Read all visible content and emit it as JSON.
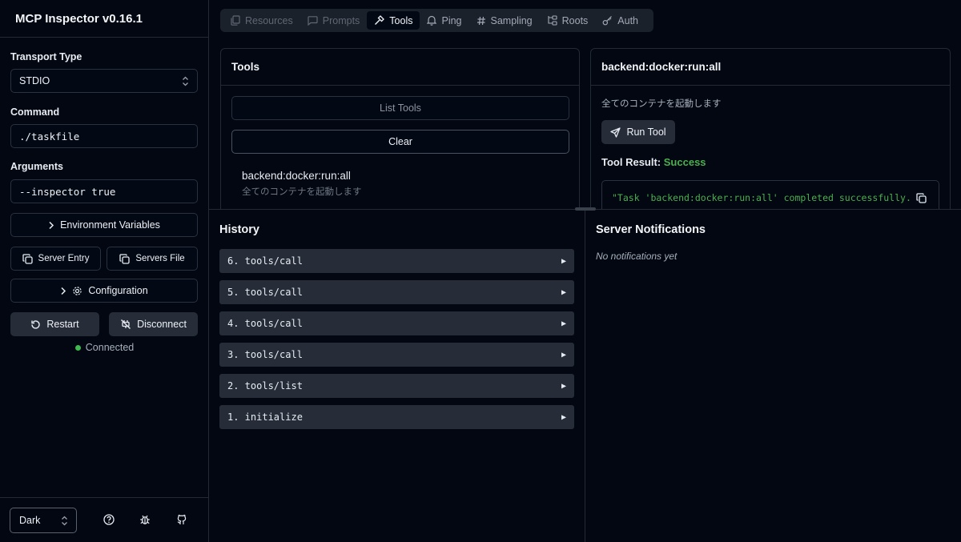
{
  "app": {
    "title": "MCP Inspector v0.16.1"
  },
  "sidebar": {
    "transport_label": "Transport Type",
    "transport_value": "STDIO",
    "command_label": "Command",
    "command_value": "./taskfile",
    "arguments_label": "Arguments",
    "arguments_value": "--inspector true",
    "env_vars_label": "Environment Variables",
    "server_entry_label": "Server Entry",
    "servers_file_label": "Servers File",
    "configuration_label": "Configuration",
    "restart_label": "Restart",
    "disconnect_label": "Disconnect",
    "status_text": "Connected",
    "status_color": "#3fb950",
    "theme_value": "Dark",
    "footer_icons": [
      "help-circle-icon",
      "bug-icon",
      "github-icon"
    ]
  },
  "tabs": [
    {
      "label": "Resources",
      "icon": "file-icon",
      "state": "disabled"
    },
    {
      "label": "Prompts",
      "icon": "message-icon",
      "state": "disabled"
    },
    {
      "label": "Tools",
      "icon": "hammer-icon",
      "state": "active"
    },
    {
      "label": "Ping",
      "icon": "bell-icon",
      "state": "normal"
    },
    {
      "label": "Sampling",
      "icon": "hash-icon",
      "state": "normal"
    },
    {
      "label": "Roots",
      "icon": "folder-tree-icon",
      "state": "normal"
    },
    {
      "label": "Auth",
      "icon": "key-icon",
      "state": "normal"
    }
  ],
  "tools_panel": {
    "title": "Tools",
    "list_tools_label": "List Tools",
    "clear_label": "Clear",
    "tool_name": "backend:docker:run:all",
    "tool_description": "全てのコンテナを起動します"
  },
  "detail_panel": {
    "title": "backend:docker:run:all",
    "description": "全てのコンテナを起動します",
    "run_tool_label": "Run Tool",
    "result_label": "Tool Result:",
    "result_status": "Success",
    "result_color": "#4caf50",
    "result_text": "\"Task 'backend:docker:run:all' completed successfully."
  },
  "history": {
    "title": "History",
    "items": [
      "6. tools/call",
      "5. tools/call",
      "4. tools/call",
      "3. tools/call",
      "2. tools/list",
      "1. initialize"
    ]
  },
  "notifications": {
    "title": "Server Notifications",
    "empty_text": "No notifications yet"
  }
}
